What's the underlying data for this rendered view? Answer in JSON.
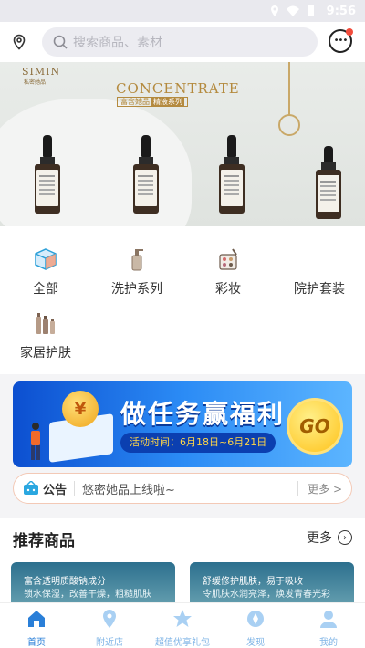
{
  "status_bar": {
    "time": "9:56"
  },
  "search": {
    "placeholder": "搜索商品、素材"
  },
  "banner": {
    "brand": "SIMIN",
    "brand_sub": "私密她品",
    "headline": "CONCENTRATE",
    "tagline_a": "富含她品",
    "tagline_b": "精液系列"
  },
  "categories": [
    {
      "label": "全部",
      "icon": "cube-icon"
    },
    {
      "label": "洗护系列",
      "icon": "pump-bottle-icon"
    },
    {
      "label": "彩妆",
      "icon": "makeup-palette-icon"
    },
    {
      "label": "院护套装",
      "icon": "kit-icon"
    },
    {
      "label": "家居护肤",
      "icon": "bottles-icon"
    }
  ],
  "promo": {
    "title": "做任务赢福利",
    "date": "活动时间：6月18日~6月21日",
    "go": "GO",
    "coin": "¥"
  },
  "notice": {
    "title": "公告",
    "text": "悠密她品上线啦~",
    "more": "更多 >"
  },
  "recommend": {
    "title": "推荐商品",
    "more": "更多",
    "cards": [
      {
        "line1": "富含透明质酸钠成分",
        "line2": "锁水保湿，改善干燥，粗糙肌肤"
      },
      {
        "line1": "舒缓修护肌肤，易于吸收",
        "line2": "令肌肤水润亮泽，焕发青春光彩"
      }
    ]
  },
  "tabbar": {
    "items": [
      {
        "label": "首页",
        "icon": "home-icon"
      },
      {
        "label": "附近店",
        "icon": "map-pin-icon"
      },
      {
        "label": "超值优享礼包",
        "icon": "star-icon"
      },
      {
        "label": "发现",
        "icon": "discover-icon"
      },
      {
        "label": "我的",
        "icon": "user-icon"
      }
    ]
  },
  "colors": {
    "accent": "#2a7fd8",
    "gold": "#b48a3e",
    "notice_border": "#f3c9b6"
  }
}
